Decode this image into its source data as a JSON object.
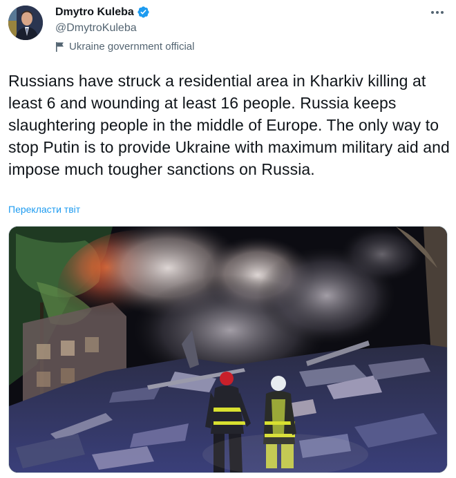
{
  "author": {
    "display_name": "Dmytro Kuleba",
    "handle": "@DmytroKuleba",
    "label": "Ukraine government official"
  },
  "tweet": {
    "text": "Russians have struck a residential area in Kharkiv killing at least 6 and wounding at least 16 people. Russia keeps slaughtering people in the middle of Europe. The only way to stop Putin is to provide Ukraine with maximum military aid and impose much tougher sanctions on Russia.",
    "translate_link": "Перекласти твіт"
  },
  "icons": {
    "verified": "verified-badge-icon",
    "label_flag": "flag-icon",
    "more": "more-icon"
  },
  "colors": {
    "accent": "#1d9bf0",
    "text": "#0f1419",
    "secondary": "#536471"
  }
}
